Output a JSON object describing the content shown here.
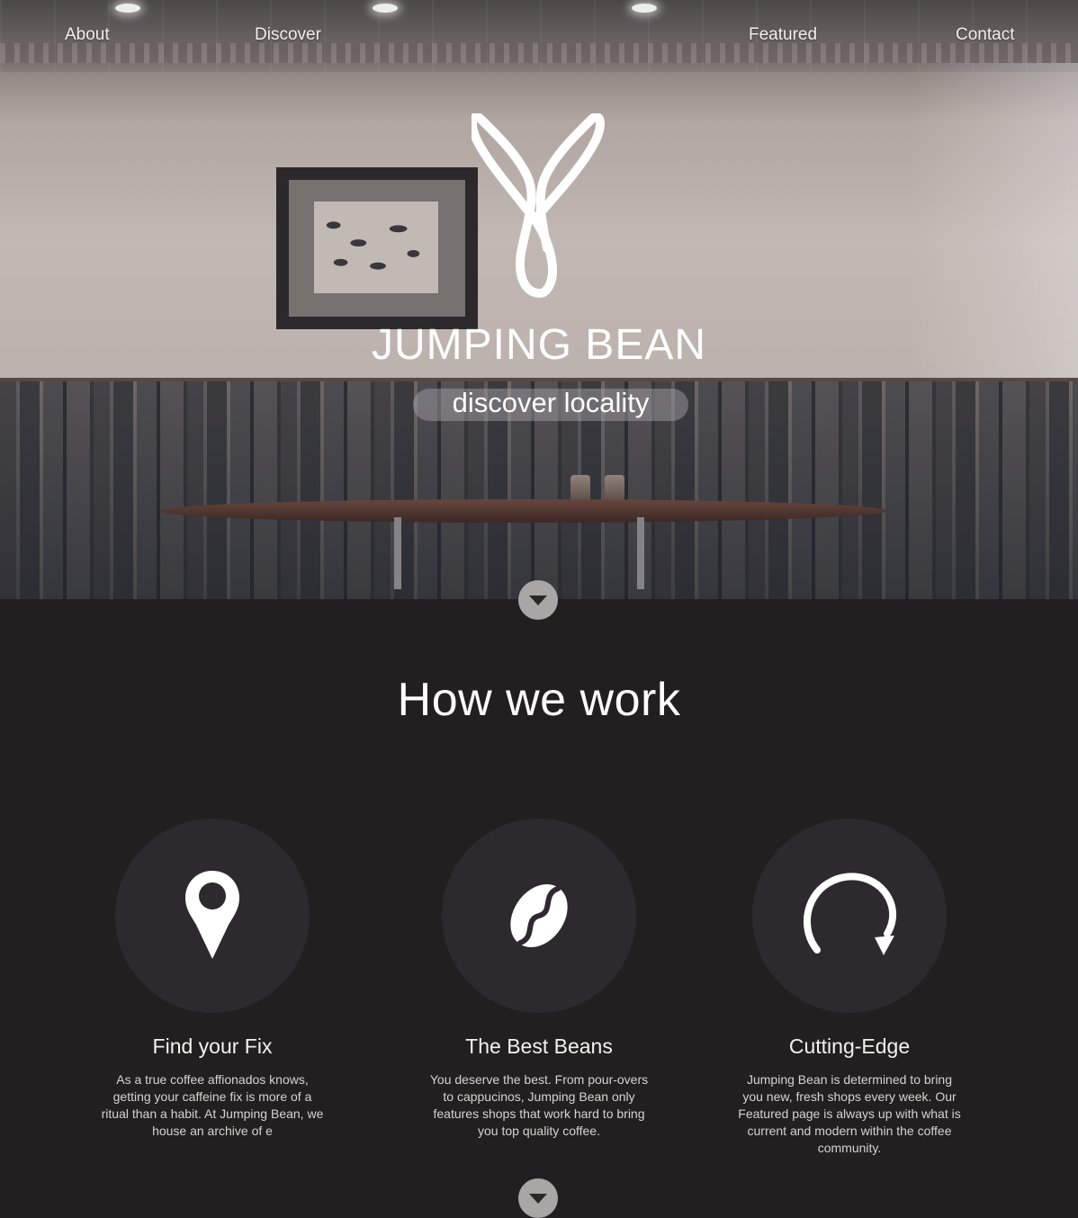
{
  "nav": {
    "items": [
      {
        "label": "About"
      },
      {
        "label": "Discover"
      },
      {
        "label": "Featured"
      },
      {
        "label": "Contact"
      }
    ]
  },
  "hero": {
    "brand_name": "JUMPING BEAN",
    "tagline": "discover locality",
    "scroll_icon": "chevron-down-icon"
  },
  "how_we_work": {
    "title": "How we work",
    "features": [
      {
        "icon": "location-pin-icon",
        "title": "Find your Fix",
        "text": "As a true coffee affionados knows, getting your caffeine fix is more of a ritual than a habit. At Jumping Bean, we house an archive of e"
      },
      {
        "icon": "coffee-bean-icon",
        "title": "The Best Beans",
        "text": "You deserve the best. From pour-overs to cappucinos, Jumping Bean only features shops that work hard to bring you top quality coffee."
      },
      {
        "icon": "refresh-icon",
        "title": "Cutting-Edge",
        "text": "Jumping Bean is determined to bring you new, fresh shops every week. Our Featured page is always up with what is current and modern within the coffee community."
      }
    ]
  },
  "colors": {
    "dark_background": "#221f20",
    "circle_background": "#2c2a2d",
    "button_grey": "#a9a7a6",
    "text_white": "#ffffff"
  }
}
